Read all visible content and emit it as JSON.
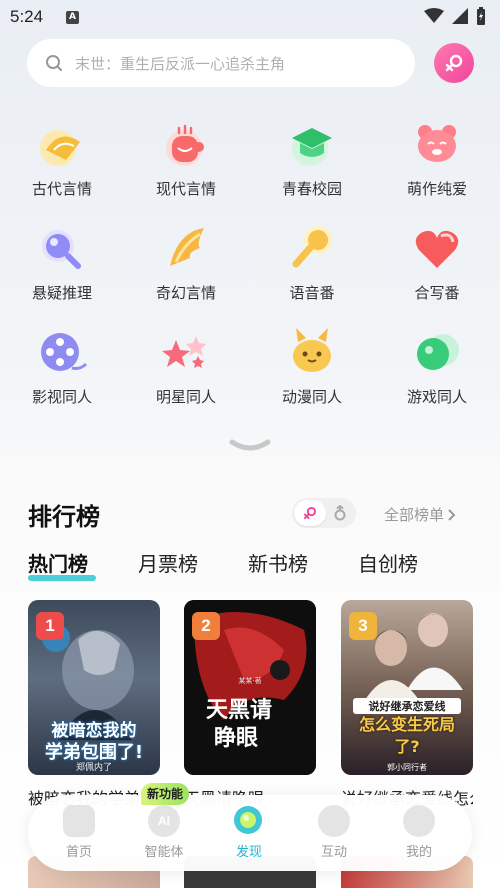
{
  "status_bar": {
    "time": "5:24",
    "notif_letter": "A"
  },
  "search": {
    "placeholder": "末世：重生后反派一心追杀主角"
  },
  "categories": [
    {
      "label": "古代言情",
      "icon": "fan-icon"
    },
    {
      "label": "现代言情",
      "icon": "coffee-cup-icon"
    },
    {
      "label": "青春校园",
      "icon": "graduation-cap-icon"
    },
    {
      "label": "萌作纯爱",
      "icon": "bear-face-icon"
    },
    {
      "label": "悬疑推理",
      "icon": "magnifier-icon"
    },
    {
      "label": "奇幻言情",
      "icon": "wing-icon"
    },
    {
      "label": "语音番",
      "icon": "microphone-icon"
    },
    {
      "label": "合写番",
      "icon": "heart-icon"
    },
    {
      "label": "影视同人",
      "icon": "film-reel-icon"
    },
    {
      "label": "明星同人",
      "icon": "stars-icon"
    },
    {
      "label": "动漫同人",
      "icon": "pikachu-icon"
    },
    {
      "label": "游戏同人",
      "icon": "game-bubble-icon"
    }
  ],
  "ranking": {
    "title": "排行榜",
    "all_lists": "全部榜单",
    "tabs": [
      "热门榜",
      "月票榜",
      "新书榜",
      "自创榜"
    ],
    "books": [
      {
        "rank": "1",
        "badge_color": "#ee4b4b",
        "cover_text_1": "被暗恋我的",
        "cover_text_2": "学弟包围了!",
        "cover_author": "郑佩内了",
        "title": "被暗恋我的学弟包围了"
      },
      {
        "rank": "2",
        "badge_color": "#f07f3c",
        "cover_text_1": "天黑请",
        "cover_text_2": "睁眼",
        "cover_author": "某某·著",
        "title": "天黑请睁眼"
      },
      {
        "rank": "3",
        "badge_color": "#f0b43c",
        "cover_text_1": "说好继承恋爱线",
        "cover_text_2": "怎么变生死局了?",
        "cover_author": "郭小同行者",
        "title": "说好继承恋爱线怎么变生死局了"
      }
    ]
  },
  "new_feature_badge": "新功能",
  "bottom_nav": [
    {
      "label": "首页",
      "icon": "home-icon"
    },
    {
      "label": "智能体",
      "icon": "ai-bubble-icon",
      "icon_text": "AI"
    },
    {
      "label": "发现",
      "icon": "discover-icon"
    },
    {
      "label": "互动",
      "icon": "chat-icon"
    },
    {
      "label": "我的",
      "icon": "profile-icon"
    }
  ],
  "colors": {
    "accent": "#22b6c8",
    "tab_underline": "#4ad0d6",
    "gender_button": "#f0449a"
  }
}
